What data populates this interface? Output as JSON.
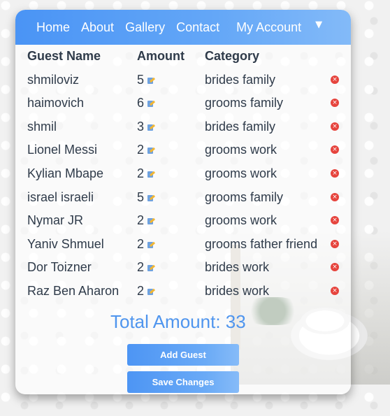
{
  "nav": {
    "home": "Home",
    "about": "About",
    "gallery": "Gallery",
    "contact": "Contact",
    "account": "My Account",
    "dropdown_icon": "caret-down-icon"
  },
  "table": {
    "headers": {
      "name": "Guest Name",
      "amount": "Amount",
      "category": "Category"
    },
    "rows": [
      {
        "name": "shmiloviz",
        "amount": "5",
        "category": "brides family"
      },
      {
        "name": "haimovich",
        "amount": "6",
        "category": "grooms family"
      },
      {
        "name": "shmil",
        "amount": "3",
        "category": "brides family"
      },
      {
        "name": "Lionel Messi",
        "amount": "2",
        "category": "grooms work"
      },
      {
        "name": "Kylian Mbape",
        "amount": "2",
        "category": "grooms work"
      },
      {
        "name": "israel israeli",
        "amount": "5",
        "category": "grooms family"
      },
      {
        "name": "Nymar JR",
        "amount": "2",
        "category": "grooms work"
      },
      {
        "name": "Yaniv Shmuel",
        "amount": "2",
        "category": "grooms father friend"
      },
      {
        "name": "Dor Toizner",
        "amount": "2",
        "category": "brides work"
      },
      {
        "name": "Raz Ben Aharon",
        "amount": "2",
        "category": "brides work"
      }
    ],
    "edit_icon": "edit-icon",
    "delete_icon": "delete-icon",
    "delete_glyph": "×"
  },
  "total": {
    "text": "Total Amount: 33"
  },
  "buttons": {
    "add": "Add Guest",
    "save": "Save Changes"
  },
  "colors": {
    "accent": "#4a94f5",
    "delete": "#e6443d",
    "total_text": "#4f95ee"
  }
}
